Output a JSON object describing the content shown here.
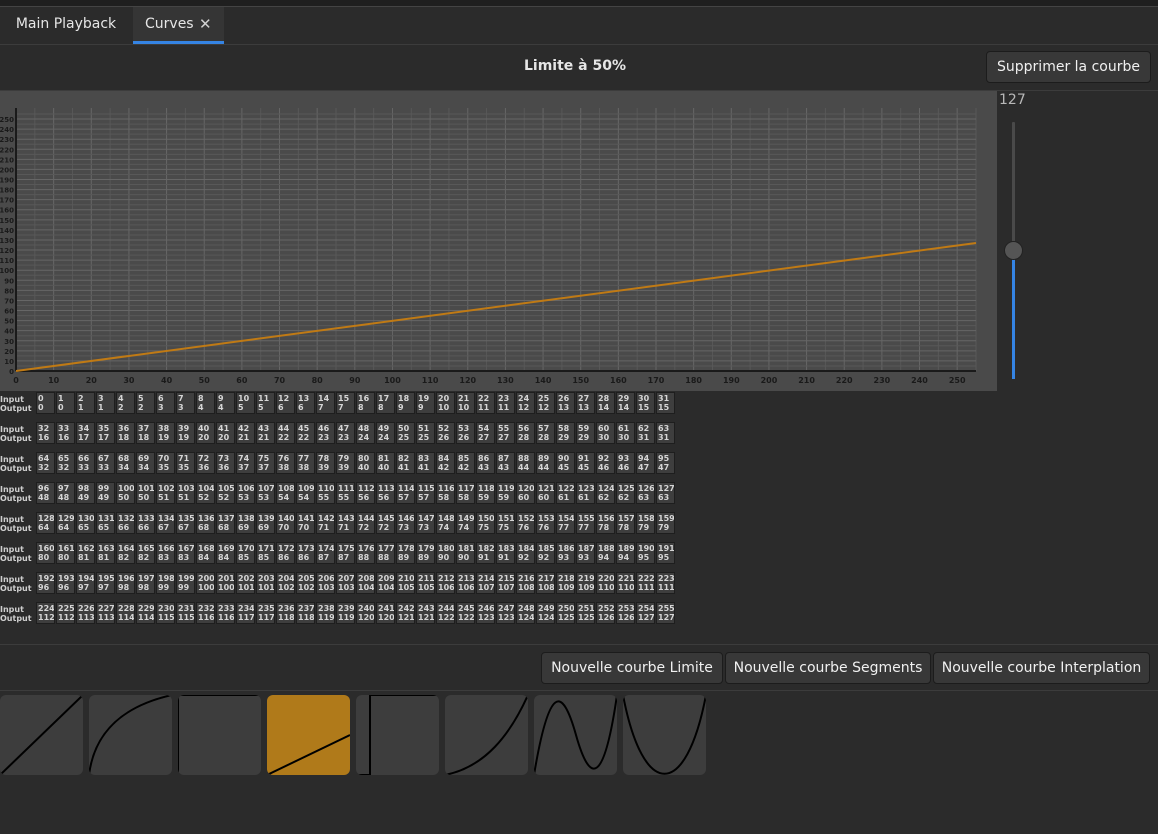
{
  "tabs": [
    {
      "label": "Main Playback"
    },
    {
      "label": "Curves",
      "close_icon": "✕"
    }
  ],
  "header": {
    "title": "Limite à 50%",
    "delete_button": "Supprimer la courbe"
  },
  "colors": {
    "accent": "#3584e4",
    "curve": "#c07a14",
    "selected_preset": "#b07a1a"
  },
  "slider": {
    "value_text": "127",
    "min": 0,
    "max": 255,
    "value": 127
  },
  "chart_data": {
    "type": "line",
    "title": "",
    "xlabel": "",
    "ylabel": "",
    "xlim": [
      0,
      255
    ],
    "ylim": [
      0,
      255
    ],
    "x_ticks": [
      "0",
      "10",
      "20",
      "30",
      "40",
      "50",
      "60",
      "70",
      "80",
      "90",
      "100",
      "110",
      "120",
      "130",
      "140",
      "150",
      "160",
      "170",
      "180",
      "190",
      "200",
      "210",
      "220",
      "230",
      "240",
      "250"
    ],
    "y_ticks": [
      "0",
      "10",
      "20",
      "30",
      "40",
      "50",
      "60",
      "70",
      "80",
      "90",
      "100",
      "110",
      "120",
      "130",
      "140",
      "150",
      "160",
      "170",
      "180",
      "190",
      "200",
      "210",
      "220",
      "230",
      "240",
      "250"
    ],
    "grid": true,
    "series": [
      {
        "x": [
          0,
          255
        ],
        "y": [
          0,
          127
        ]
      }
    ]
  },
  "table": {
    "input_label": "Input",
    "output_label": "Output",
    "rows": [
      {
        "inputs": [
          "0",
          "1",
          "2",
          "3",
          "4",
          "5",
          "6",
          "7",
          "8",
          "9",
          "10",
          "11",
          "12",
          "13",
          "14",
          "15",
          "16",
          "17",
          "18",
          "19",
          "20",
          "21",
          "22",
          "23",
          "24",
          "25",
          "26",
          "27",
          "28",
          "29",
          "30",
          "31"
        ],
        "outputs": [
          "0",
          "0",
          "1",
          "1",
          "2",
          "2",
          "3",
          "3",
          "4",
          "4",
          "5",
          "5",
          "6",
          "6",
          "7",
          "7",
          "8",
          "8",
          "9",
          "9",
          "10",
          "10",
          "11",
          "11",
          "12",
          "12",
          "13",
          "13",
          "14",
          "14",
          "15",
          "15"
        ]
      },
      {
        "inputs": [
          "32",
          "33",
          "34",
          "35",
          "36",
          "37",
          "38",
          "39",
          "40",
          "41",
          "42",
          "43",
          "44",
          "45",
          "46",
          "47",
          "48",
          "49",
          "50",
          "51",
          "52",
          "53",
          "54",
          "55",
          "56",
          "57",
          "58",
          "59",
          "60",
          "61",
          "62",
          "63"
        ],
        "outputs": [
          "16",
          "16",
          "17",
          "17",
          "18",
          "18",
          "19",
          "19",
          "20",
          "20",
          "21",
          "21",
          "22",
          "22",
          "23",
          "23",
          "24",
          "24",
          "25",
          "25",
          "26",
          "26",
          "27",
          "27",
          "28",
          "28",
          "29",
          "29",
          "30",
          "30",
          "31",
          "31"
        ]
      },
      {
        "inputs": [
          "64",
          "65",
          "66",
          "67",
          "68",
          "69",
          "70",
          "71",
          "72",
          "73",
          "74",
          "75",
          "76",
          "77",
          "78",
          "79",
          "80",
          "81",
          "82",
          "83",
          "84",
          "85",
          "86",
          "87",
          "88",
          "89",
          "90",
          "91",
          "92",
          "93",
          "94",
          "95"
        ],
        "outputs": [
          "32",
          "32",
          "33",
          "33",
          "34",
          "34",
          "35",
          "35",
          "36",
          "36",
          "37",
          "37",
          "38",
          "38",
          "39",
          "39",
          "40",
          "40",
          "41",
          "41",
          "42",
          "42",
          "43",
          "43",
          "44",
          "44",
          "45",
          "45",
          "46",
          "46",
          "47",
          "47"
        ]
      },
      {
        "inputs": [
          "96",
          "97",
          "98",
          "99",
          "100",
          "101",
          "102",
          "103",
          "104",
          "105",
          "106",
          "107",
          "108",
          "109",
          "110",
          "111",
          "112",
          "113",
          "114",
          "115",
          "116",
          "117",
          "118",
          "119",
          "120",
          "121",
          "122",
          "123",
          "124",
          "125",
          "126",
          "127"
        ],
        "outputs": [
          "48",
          "48",
          "49",
          "49",
          "50",
          "50",
          "51",
          "51",
          "52",
          "52",
          "53",
          "53",
          "54",
          "54",
          "55",
          "55",
          "56",
          "56",
          "57",
          "57",
          "58",
          "58",
          "59",
          "59",
          "60",
          "60",
          "61",
          "61",
          "62",
          "62",
          "63",
          "63"
        ]
      },
      {
        "inputs": [
          "128",
          "129",
          "130",
          "131",
          "132",
          "133",
          "134",
          "135",
          "136",
          "137",
          "138",
          "139",
          "140",
          "141",
          "142",
          "143",
          "144",
          "145",
          "146",
          "147",
          "148",
          "149",
          "150",
          "151",
          "152",
          "153",
          "154",
          "155",
          "156",
          "157",
          "158",
          "159"
        ],
        "outputs": [
          "64",
          "64",
          "65",
          "65",
          "66",
          "66",
          "67",
          "67",
          "68",
          "68",
          "69",
          "69",
          "70",
          "70",
          "71",
          "71",
          "72",
          "72",
          "73",
          "73",
          "74",
          "74",
          "75",
          "75",
          "76",
          "76",
          "77",
          "77",
          "78",
          "78",
          "79",
          "79"
        ]
      },
      {
        "inputs": [
          "160",
          "161",
          "162",
          "163",
          "164",
          "165",
          "166",
          "167",
          "168",
          "169",
          "170",
          "171",
          "172",
          "173",
          "174",
          "175",
          "176",
          "177",
          "178",
          "179",
          "180",
          "181",
          "182",
          "183",
          "184",
          "185",
          "186",
          "187",
          "188",
          "189",
          "190",
          "191"
        ],
        "outputs": [
          "80",
          "80",
          "81",
          "81",
          "82",
          "82",
          "83",
          "83",
          "84",
          "84",
          "85",
          "85",
          "86",
          "86",
          "87",
          "87",
          "88",
          "88",
          "89",
          "89",
          "90",
          "90",
          "91",
          "91",
          "92",
          "92",
          "93",
          "93",
          "94",
          "94",
          "95",
          "95"
        ]
      },
      {
        "inputs": [
          "192",
          "193",
          "194",
          "195",
          "196",
          "197",
          "198",
          "199",
          "200",
          "201",
          "202",
          "203",
          "204",
          "205",
          "206",
          "207",
          "208",
          "209",
          "210",
          "211",
          "212",
          "213",
          "214",
          "215",
          "216",
          "217",
          "218",
          "219",
          "220",
          "221",
          "222",
          "223"
        ],
        "outputs": [
          "96",
          "96",
          "97",
          "97",
          "98",
          "98",
          "99",
          "99",
          "100",
          "100",
          "101",
          "101",
          "102",
          "102",
          "103",
          "103",
          "104",
          "104",
          "105",
          "105",
          "106",
          "106",
          "107",
          "107",
          "108",
          "108",
          "109",
          "109",
          "110",
          "110",
          "111",
          "111"
        ]
      },
      {
        "inputs": [
          "224",
          "225",
          "226",
          "227",
          "228",
          "229",
          "230",
          "231",
          "232",
          "233",
          "234",
          "235",
          "236",
          "237",
          "238",
          "239",
          "240",
          "241",
          "242",
          "243",
          "244",
          "245",
          "246",
          "247",
          "248",
          "249",
          "250",
          "251",
          "252",
          "253",
          "254",
          "255"
        ],
        "outputs": [
          "112",
          "112",
          "113",
          "113",
          "114",
          "114",
          "115",
          "115",
          "116",
          "116",
          "117",
          "117",
          "118",
          "118",
          "119",
          "119",
          "120",
          "120",
          "121",
          "121",
          "122",
          "122",
          "123",
          "123",
          "124",
          "124",
          "125",
          "125",
          "126",
          "126",
          "127",
          "127"
        ]
      }
    ]
  },
  "actions": {
    "new_limit": "Nouvelle courbe Limite",
    "new_segments": "Nouvelle courbe Segments",
    "new_interpolation": "Nouvelle courbe Interplation"
  },
  "presets": [
    {
      "name": "linear"
    },
    {
      "name": "square-root"
    },
    {
      "name": "full"
    },
    {
      "name": "limit-50",
      "selected": true
    },
    {
      "name": "full-offset"
    },
    {
      "name": "square"
    },
    {
      "name": "sine-wave"
    },
    {
      "name": "parabola"
    }
  ]
}
